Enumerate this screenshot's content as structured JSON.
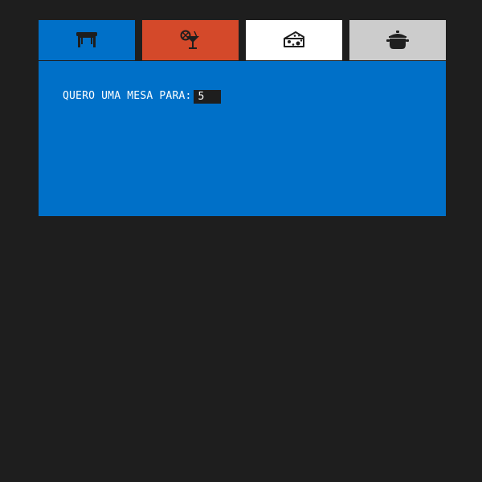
{
  "tabs": [
    {
      "id": "table",
      "icon": "table-icon",
      "color": "#0070c8",
      "selected": true
    },
    {
      "id": "drinks",
      "icon": "cocktail-icon",
      "color": "#d4492a"
    },
    {
      "id": "cheese",
      "icon": "cheese-icon",
      "color": "#ffffff"
    },
    {
      "id": "pot",
      "icon": "pot-icon",
      "color": "#cccccc"
    }
  ],
  "panel": {
    "color": "#0070c8",
    "label": "QUERO UMA MESA PARA:",
    "guests_value": "5"
  },
  "background": "#1e1e1e"
}
